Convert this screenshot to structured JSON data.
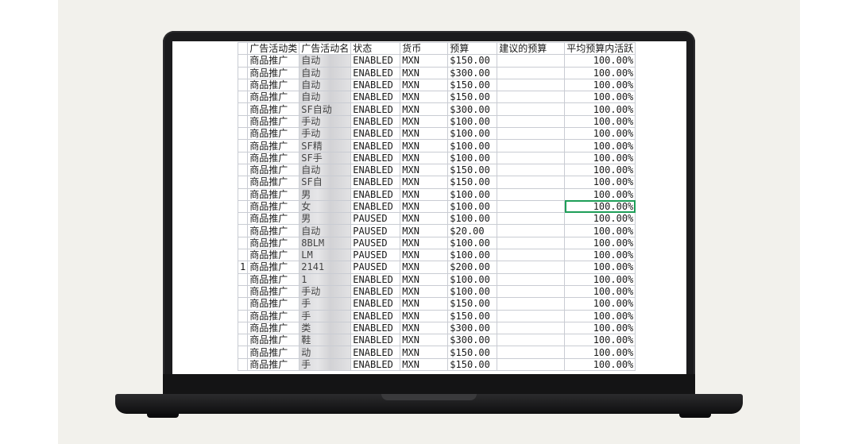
{
  "columns": [
    "广告活动类",
    "广告活动名",
    "状态",
    "货币",
    "预算",
    "建议的预算",
    "平均预算内活跃"
  ],
  "rows": [
    {
      "edge": "",
      "type": "商品推广",
      "name": "自动",
      "status": "ENABLED",
      "currency": "MXN",
      "budget": "$150.00",
      "suggested": "",
      "avg": "100.00%"
    },
    {
      "edge": "",
      "type": "商品推广",
      "name": "自动",
      "status": "ENABLED",
      "currency": "MXN",
      "budget": "$300.00",
      "suggested": "",
      "avg": "100.00%"
    },
    {
      "edge": "",
      "type": "商品推广",
      "name": "自动",
      "status": "ENABLED",
      "currency": "MXN",
      "budget": "$150.00",
      "suggested": "",
      "avg": "100.00%"
    },
    {
      "edge": "",
      "type": "商品推广",
      "name": "自动",
      "status": "ENABLED",
      "currency": "MXN",
      "budget": "$150.00",
      "suggested": "",
      "avg": "100.00%"
    },
    {
      "edge": "",
      "type": "商品推广",
      "name": "SF自动",
      "status": "ENABLED",
      "currency": "MXN",
      "budget": "$300.00",
      "suggested": "",
      "avg": "100.00%"
    },
    {
      "edge": "",
      "type": "商品推广",
      "name": "手动",
      "status": "ENABLED",
      "currency": "MXN",
      "budget": "$100.00",
      "suggested": "",
      "avg": "100.00%"
    },
    {
      "edge": "",
      "type": "商品推广",
      "name": "手动",
      "status": "ENABLED",
      "currency": "MXN",
      "budget": "$100.00",
      "suggested": "",
      "avg": "100.00%"
    },
    {
      "edge": "",
      "type": "商品推广",
      "name": "SF精",
      "status": "ENABLED",
      "currency": "MXN",
      "budget": "$100.00",
      "suggested": "",
      "avg": "100.00%"
    },
    {
      "edge": "",
      "type": "商品推广",
      "name": "SF手",
      "status": "ENABLED",
      "currency": "MXN",
      "budget": "$100.00",
      "suggested": "",
      "avg": "100.00%"
    },
    {
      "edge": "",
      "type": "商品推广",
      "name": "自动",
      "status": "ENABLED",
      "currency": "MXN",
      "budget": "$150.00",
      "suggested": "",
      "avg": "100.00%"
    },
    {
      "edge": "",
      "type": "商品推广",
      "name": "SF自",
      "status": "ENABLED",
      "currency": "MXN",
      "budget": "$150.00",
      "suggested": "",
      "avg": "100.00%"
    },
    {
      "edge": "",
      "type": "商品推广",
      "name": "男",
      "status": "ENABLED",
      "currency": "MXN",
      "budget": "$100.00",
      "suggested": "",
      "avg": "100.00%"
    },
    {
      "edge": "",
      "type": "商品推广",
      "name": "女",
      "status": "ENABLED",
      "currency": "MXN",
      "budget": "$100.00",
      "suggested": "",
      "avg": "100.00%",
      "selected": true
    },
    {
      "edge": "",
      "type": "商品推广",
      "name": "男",
      "status": "PAUSED",
      "currency": "MXN",
      "budget": "$100.00",
      "suggested": "",
      "avg": "100.00%"
    },
    {
      "edge": "",
      "type": "商品推广",
      "name": "自动",
      "status": "PAUSED",
      "currency": "MXN",
      "budget": "$20.00",
      "suggested": "",
      "avg": "100.00%"
    },
    {
      "edge": "",
      "type": "商品推广",
      "name": "8BLM",
      "status": "PAUSED",
      "currency": "MXN",
      "budget": "$100.00",
      "suggested": "",
      "avg": "100.00%"
    },
    {
      "edge": "",
      "type": "商品推广",
      "name": "LM",
      "status": "PAUSED",
      "currency": "MXN",
      "budget": "$100.00",
      "suggested": "",
      "avg": "100.00%"
    },
    {
      "edge": "1",
      "type": "商品推广",
      "name": "2141",
      "status": "PAUSED",
      "currency": "MXN",
      "budget": "$200.00",
      "suggested": "",
      "avg": "100.00%"
    },
    {
      "edge": "",
      "type": "商品推广",
      "name": "1",
      "status": "ENABLED",
      "currency": "MXN",
      "budget": "$100.00",
      "suggested": "",
      "avg": "100.00%"
    },
    {
      "edge": "",
      "type": "商品推广",
      "name": "手动",
      "status": "ENABLED",
      "currency": "MXN",
      "budget": "$100.00",
      "suggested": "",
      "avg": "100.00%"
    },
    {
      "edge": "",
      "type": "商品推广",
      "name": "手",
      "status": "ENABLED",
      "currency": "MXN",
      "budget": "$150.00",
      "suggested": "",
      "avg": "100.00%"
    },
    {
      "edge": "",
      "type": "商品推广",
      "name": "手",
      "status": "ENABLED",
      "currency": "MXN",
      "budget": "$150.00",
      "suggested": "",
      "avg": "100.00%"
    },
    {
      "edge": "",
      "type": "商品推广",
      "name": "类",
      "status": "ENABLED",
      "currency": "MXN",
      "budget": "$300.00",
      "suggested": "",
      "avg": "100.00%"
    },
    {
      "edge": "",
      "type": "商品推广",
      "name": "鞋",
      "status": "ENABLED",
      "currency": "MXN",
      "budget": "$300.00",
      "suggested": "",
      "avg": "100.00%"
    },
    {
      "edge": "",
      "type": "商品推广",
      "name": "动",
      "status": "ENABLED",
      "currency": "MXN",
      "budget": "$150.00",
      "suggested": "",
      "avg": "100.00%"
    },
    {
      "edge": "",
      "type": "商品推广",
      "name": "手",
      "status": "ENABLED",
      "currency": "MXN",
      "budget": "$150.00",
      "suggested": "",
      "avg": "100.00%"
    }
  ],
  "colors": {
    "selection": "#1e9e58",
    "gridline": "#c9ccd3"
  }
}
